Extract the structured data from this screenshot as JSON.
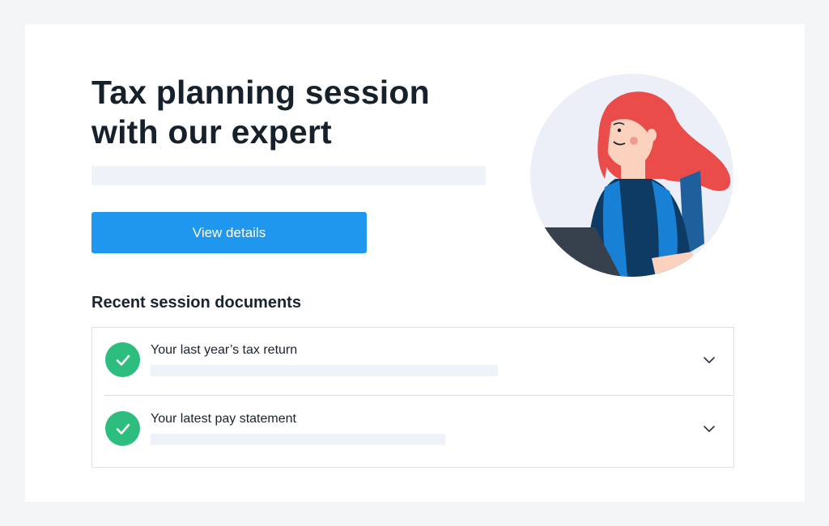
{
  "header": {
    "title_line1": "Tax planning session",
    "title_line2": "with our expert"
  },
  "actions": {
    "view_details_label": "View details"
  },
  "documents": {
    "section_title": "Recent session documents",
    "items": [
      {
        "label": "Your last year’s tax return",
        "status": "completed"
      },
      {
        "label": "Your latest pay statement",
        "status": "completed"
      }
    ]
  },
  "icons": {
    "check": "check-icon",
    "expand": "chevron-down-icon",
    "avatar": "expert-avatar"
  },
  "colors": {
    "primary_button": "#1f97ee",
    "success": "#2dbd7e",
    "placeholder": "#eef2f9"
  }
}
